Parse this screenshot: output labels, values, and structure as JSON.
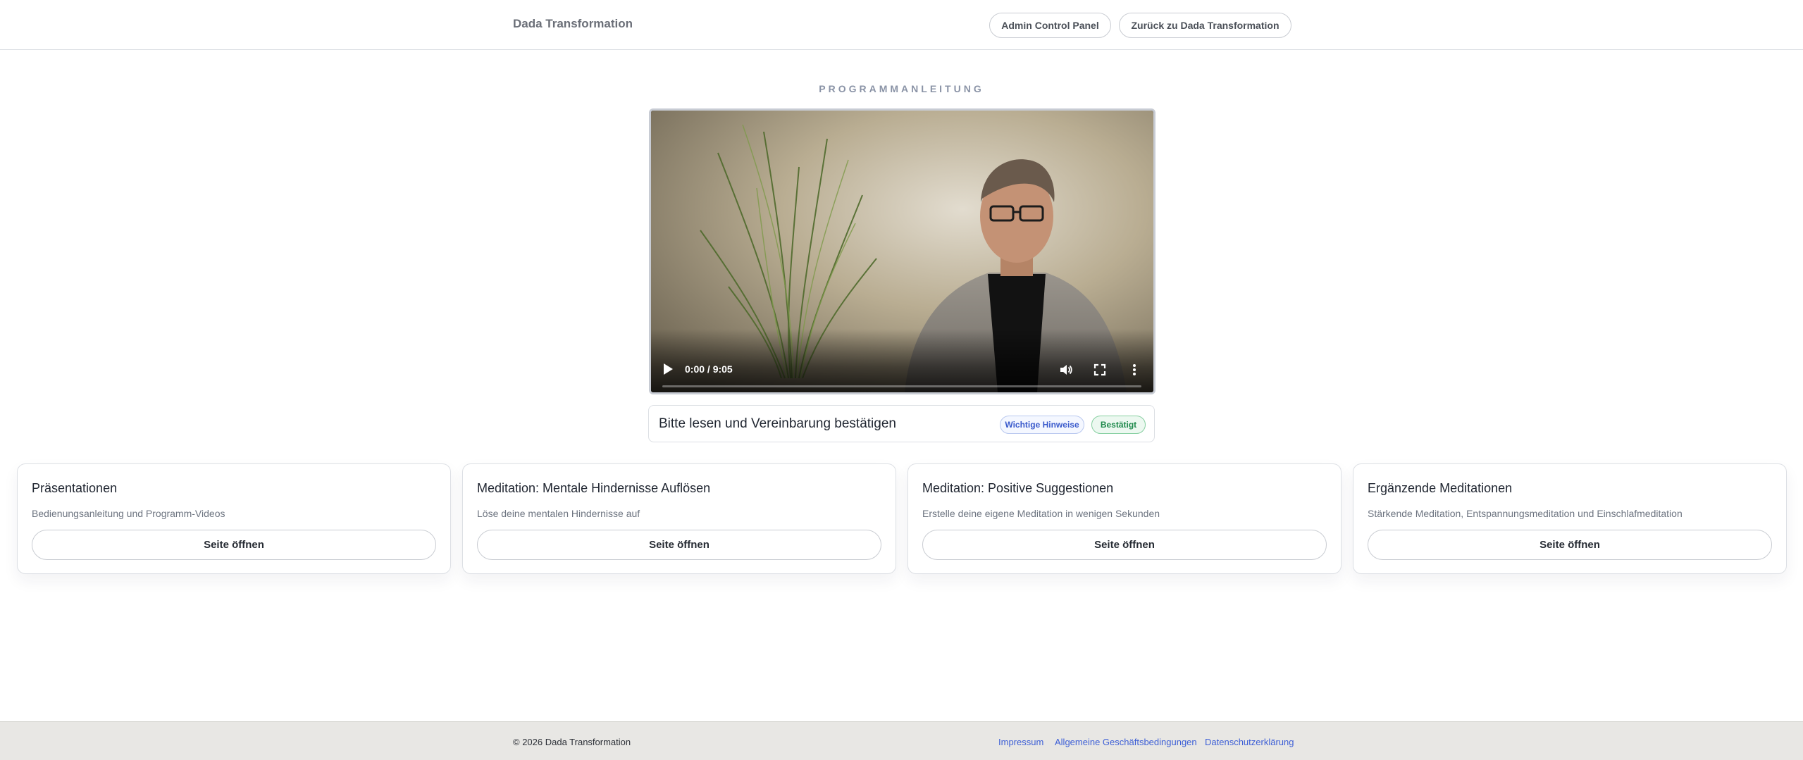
{
  "header": {
    "brand": "Dada Transformation",
    "admin_button": "Admin Control Panel",
    "back_button": "Zurück zu Dada Transformation"
  },
  "section": {
    "label": "PROGRAMMANLEITUNG"
  },
  "video": {
    "time": "0:00 / 9:05",
    "progress": 0,
    "icons": [
      "play-icon",
      "volume-icon",
      "fullscreen-icon",
      "more-options-icon"
    ]
  },
  "agreement": {
    "text": "Bitte lesen und Vereinbarung bestätigen",
    "badge_info": "Wichtige Hinweise",
    "badge_ok": "Bestätigt"
  },
  "cards": [
    {
      "title": "Präsentationen",
      "desc": "Bedienungsanleitung und Programm-Videos",
      "button": "Seite öffnen"
    },
    {
      "title": "Meditation: Mentale Hindernisse Auflösen",
      "desc": "Löse deine mentalen Hindernisse auf",
      "button": "Seite öffnen"
    },
    {
      "title": "Meditation: Positive Suggestionen",
      "desc": "Erstelle deine eigene Meditation in wenigen Sekunden",
      "button": "Seite öffnen"
    },
    {
      "title": "Ergänzende Meditationen",
      "desc": "Stärkende Meditation, Entspannungsmeditation und Einschlafmeditation",
      "button": "Seite öffnen"
    }
  ],
  "footer": {
    "copyright": "© 2026 Dada Transformation",
    "links": [
      "Impressum",
      "Allgemeine Geschäftsbedingungen",
      "Datenschutzerklärung"
    ]
  },
  "colors": {
    "link": "#3d5fd6",
    "badge_info": "#3b5bcc",
    "badge_ok": "#1f8a4c",
    "footer_bg": "#e8e7e4"
  }
}
